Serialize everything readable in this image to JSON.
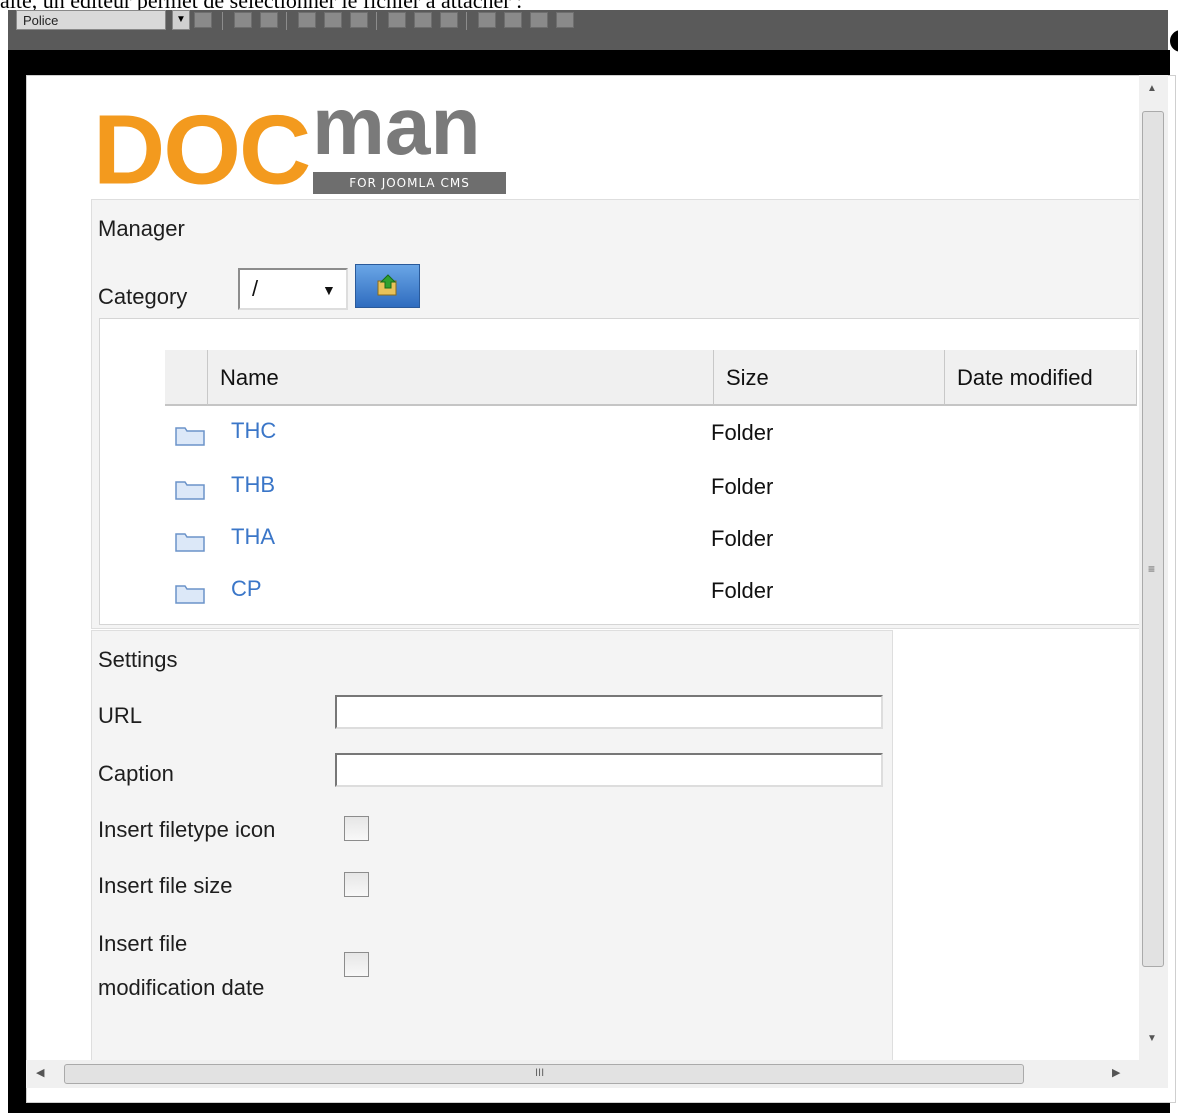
{
  "background_caption": "aite, un éditeur permet de sélectionner le fichier à attacher :",
  "toolbar": {
    "font_select": "Police"
  },
  "logo": {
    "doc": "DOC",
    "man": "man",
    "tagline": "FOR JOOMLA CMS"
  },
  "manager": {
    "title": "Manager",
    "category_label": "Category",
    "category_value": "/",
    "columns": [
      "Name",
      "Size",
      "Date modified"
    ],
    "rows": [
      {
        "name": "THC",
        "size": "Folder",
        "date": ""
      },
      {
        "name": "THB",
        "size": "Folder",
        "date": ""
      },
      {
        "name": "THA",
        "size": "Folder",
        "date": ""
      },
      {
        "name": "CP",
        "size": "Folder",
        "date": ""
      }
    ]
  },
  "settings": {
    "title": "Settings",
    "url_label": "URL",
    "url_value": "",
    "caption_label": "Caption",
    "caption_value": "",
    "filetype_icon_label": "Insert filetype icon",
    "file_size_label": "Insert file size",
    "mod_date_label_1": "Insert file",
    "mod_date_label_2": "modification date"
  },
  "colors": {
    "orange": "#f39a1e",
    "gray_logo": "#7a7a7a",
    "link_blue": "#3a76c8"
  }
}
